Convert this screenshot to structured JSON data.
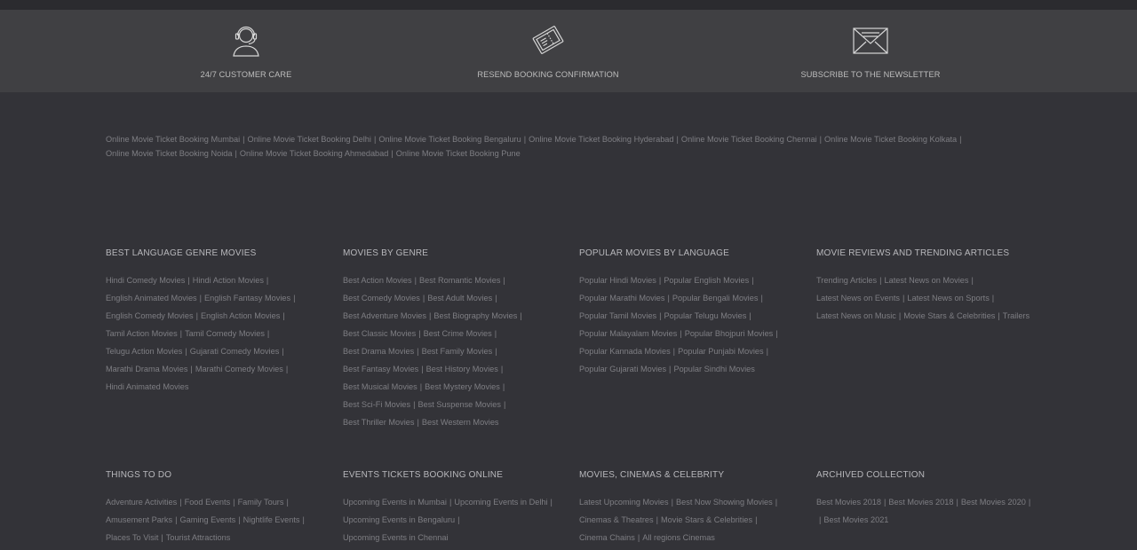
{
  "services": [
    {
      "label": "24/7 CUSTOMER CARE",
      "icon": "headset-icon"
    },
    {
      "label": "RESEND BOOKING CONFIRMATION",
      "icon": "ticket-icon"
    },
    {
      "label": "SUBSCRIBE TO THE NEWSLETTER",
      "icon": "envelope-icon"
    }
  ],
  "cities": [
    "Online Movie Ticket Booking Mumbai",
    "Online Movie Ticket Booking Delhi",
    "Online Movie Ticket Booking Bengaluru",
    "Online Movie Ticket Booking Hyderabad",
    "Online Movie Ticket Booking Chennai",
    "Online Movie Ticket Booking Kolkata",
    "Online Movie Ticket Booking Noida",
    "Online Movie Ticket Booking Ahmedabad",
    "Online Movie Ticket Booking Pune"
  ],
  "sections_row1": [
    {
      "title": "BEST LANGUAGE GENRE MOVIES",
      "lines": [
        [
          "Hindi Comedy Movies",
          "Hindi Action Movies"
        ],
        [
          "English Animated Movies",
          "English Fantasy Movies"
        ],
        [
          "English Comedy Movies",
          "English Action Movies"
        ],
        [
          "Tamil Action Movies",
          "Tamil Comedy Movies"
        ],
        [
          "Telugu Action Movies",
          "Gujarati Comedy Movies"
        ],
        [
          "Marathi Drama Movies",
          "Marathi Comedy Movies"
        ],
        [
          "Hindi Animated Movies"
        ]
      ]
    },
    {
      "title": "MOVIES BY GENRE",
      "lines": [
        [
          "Best Action Movies",
          "Best Romantic Movies"
        ],
        [
          "Best Comedy Movies",
          "Best Adult Movies"
        ],
        [
          "Best Adventure Movies",
          "Best Biography Movies"
        ],
        [
          "Best Classic Movies",
          "Best Crime Movies"
        ],
        [
          "Best Drama Movies",
          "Best Family Movies"
        ],
        [
          "Best Fantasy Movies",
          "Best History Movies"
        ],
        [
          "Best Musical Movies",
          "Best Mystery Movies"
        ],
        [
          "Best Sci-Fi Movies",
          "Best Suspense Movies"
        ],
        [
          "Best Thriller Movies",
          "Best Western Movies"
        ]
      ]
    },
    {
      "title": "POPULAR MOVIES BY LANGUAGE",
      "lines": [
        [
          "Popular Hindi Movies",
          "Popular English Movies"
        ],
        [
          "Popular Marathi Movies",
          "Popular Bengali Movies"
        ],
        [
          "Popular Tamil Movies",
          "Popular Telugu Movies"
        ],
        [
          "Popular Malayalam Movies",
          "Popular Bhojpuri Movies"
        ],
        [
          "Popular Kannada Movies",
          "Popular Punjabi Movies"
        ],
        [
          "Popular Gujarati Movies",
          "Popular Sindhi Movies"
        ]
      ]
    },
    {
      "title": "MOVIE REVIEWS AND TRENDING ARTICLES",
      "lines": [
        [
          "Trending Articles",
          "Latest News on Movies"
        ],
        [
          "Latest News on Events",
          "Latest News on Sports"
        ],
        [
          "Latest News on Music",
          "Movie Stars & Celebrities",
          "Trailers"
        ]
      ]
    }
  ],
  "sections_row2": [
    {
      "title": "THINGS TO DO",
      "lines": [
        [
          "Adventure Activities",
          "Food Events",
          "Family Tours"
        ],
        [
          "Amusement Parks",
          "Gaming Events",
          "Nightlife Events"
        ],
        [
          "Places To Visit",
          "Tourist Attractions"
        ]
      ]
    },
    {
      "title": "EVENTS TICKETS BOOKING ONLINE",
      "lines": [
        [
          "Upcoming Events in Mumbai",
          "Upcoming Events in Delhi"
        ],
        [
          "Upcoming Events in Bengaluru"
        ],
        [
          "Upcoming Events in Chennai"
        ]
      ]
    },
    {
      "title": "MOVIES, CINEMAS & CELEBRITY",
      "lines": [
        [
          "Latest Upcoming Movies",
          "Best Now Showing Movies"
        ],
        [
          "Cinemas & Theatres",
          "Movie Stars & Celebrities"
        ],
        [
          "Cinema Chains",
          "All regions Cinemas"
        ]
      ]
    },
    {
      "title": "ARCHIVED COLLECTION",
      "lines": [
        [
          "Best Movies 2018",
          "Best Movies 2018",
          "Best Movies 2020"
        ],
        [
          "",
          "Best Movies 2021"
        ]
      ]
    }
  ]
}
